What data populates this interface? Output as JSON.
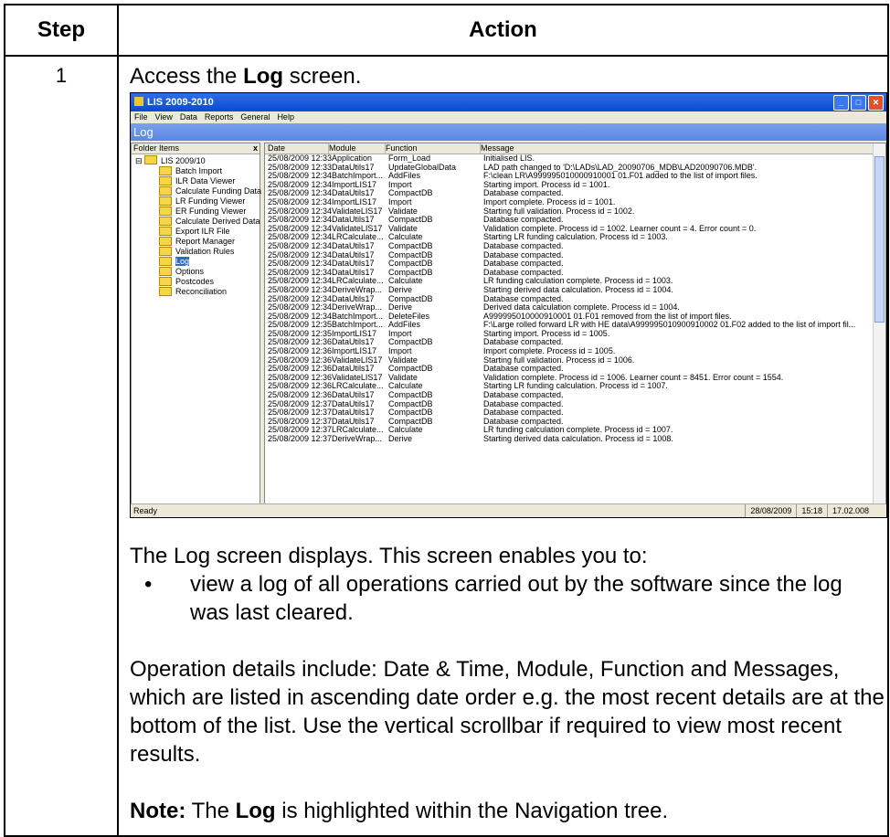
{
  "table": {
    "step_header": "Step",
    "action_header": "Action",
    "step_number": "1"
  },
  "intro": {
    "prefix": "Access the ",
    "bold": "Log",
    "suffix": " screen."
  },
  "screenshot": {
    "app_title": "LIS 2009-2010",
    "menu": [
      "File",
      "View",
      "Data",
      "Reports",
      "General",
      "Help"
    ],
    "screen_title": "Log",
    "folder_panel_title": "Folder Items",
    "tree_root": "LIS 2009/10",
    "tree_items": [
      "Batch Import",
      "ILR Data Viewer",
      "Calculate Funding Data",
      "LR Funding Viewer",
      "ER Funding Viewer",
      "Calculate Derived Data",
      "Export ILR File",
      "Report Manager",
      "Validation Rules",
      "Log",
      "Options",
      "Postcodes",
      "Reconciliation"
    ],
    "selected_item": "Log",
    "columns": [
      "Date",
      "Module",
      "Function",
      "Message"
    ],
    "rows": [
      [
        "25/08/2009 12:33",
        "Application",
        "Form_Load",
        "Initialised LIS."
      ],
      [
        "25/08/2009 12:33",
        "DataUtils17",
        "UpdateGlobalData",
        "LAD path changed to 'D:\\LADs\\LAD_20090706_MDB\\LAD20090706.MDB'."
      ],
      [
        "25/08/2009 12:34",
        "BatchImport...",
        "AddFiles",
        "F:\\clean LR\\A999995010000910001 01.F01 added to the list of import files."
      ],
      [
        "25/08/2009 12:34",
        "ImportLIS17",
        "Import",
        "Starting import. Process id = 1001."
      ],
      [
        "25/08/2009 12:34",
        "DataUtils17",
        "CompactDB",
        "Database compacted."
      ],
      [
        "25/08/2009 12:34",
        "ImportLIS17",
        "Import",
        "Import complete. Process id = 1001."
      ],
      [
        "25/08/2009 12:34",
        "ValidateLIS17",
        "Validate",
        "Starting full validation. Process id = 1002."
      ],
      [
        "25/08/2009 12:34",
        "DataUtils17",
        "CompactDB",
        "Database compacted."
      ],
      [
        "25/08/2009 12:34",
        "ValidateLIS17",
        "Validate",
        "Validation complete. Process id = 1002. Learner count = 4. Error count = 0."
      ],
      [
        "25/08/2009 12:34",
        "LRCalculate...",
        "Calculate",
        "Starting LR funding calculation. Process id = 1003."
      ],
      [
        "25/08/2009 12:34",
        "DataUtils17",
        "CompactDB",
        "Database compacted."
      ],
      [
        "25/08/2009 12:34",
        "DataUtils17",
        "CompactDB",
        "Database compacted."
      ],
      [
        "25/08/2009 12:34",
        "DataUtils17",
        "CompactDB",
        "Database compacted."
      ],
      [
        "25/08/2009 12:34",
        "DataUtils17",
        "CompactDB",
        "Database compacted."
      ],
      [
        "25/08/2009 12:34",
        "LRCalculate...",
        "Calculate",
        "LR funding calculation complete. Process id = 1003."
      ],
      [
        "25/08/2009 12:34",
        "DeriveWrap...",
        "Derive",
        "Starting derived data calculation. Process id = 1004."
      ],
      [
        "25/08/2009 12:34",
        "DataUtils17",
        "CompactDB",
        "Database compacted."
      ],
      [
        "25/08/2009 12:34",
        "DeriveWrap...",
        "Derive",
        "Derived data calculation complete. Process id = 1004."
      ],
      [
        "25/08/2009 12:34",
        "BatchImport...",
        "DeleteFiles",
        "A999995010000910001 01.F01 removed from the list of import files."
      ],
      [
        "25/08/2009 12:35",
        "BatchImport...",
        "AddFiles",
        "F:\\Large rolled forward LR with HE data\\A999995010900910002 01.F02 added to the list of import fil..."
      ],
      [
        "25/08/2009 12:35",
        "ImportLIS17",
        "Import",
        "Starting import. Process id = 1005."
      ],
      [
        "25/08/2009 12:36",
        "DataUtils17",
        "CompactDB",
        "Database compacted."
      ],
      [
        "25/08/2009 12:36",
        "ImportLIS17",
        "Import",
        "Import complete. Process id = 1005."
      ],
      [
        "25/08/2009 12:36",
        "ValidateLIS17",
        "Validate",
        "Starting full validation. Process id = 1006."
      ],
      [
        "25/08/2009 12:36",
        "DataUtils17",
        "CompactDB",
        "Database compacted."
      ],
      [
        "25/08/2009 12:36",
        "ValidateLIS17",
        "Validate",
        "Validation complete. Process id = 1006. Learner count = 8451. Error count = 1554."
      ],
      [
        "25/08/2009 12:36",
        "LRCalculate...",
        "Calculate",
        "Starting LR funding calculation. Process id = 1007."
      ],
      [
        "25/08/2009 12:36",
        "DataUtils17",
        "CompactDB",
        "Database compacted."
      ],
      [
        "25/08/2009 12:37",
        "DataUtils17",
        "CompactDB",
        "Database compacted."
      ],
      [
        "25/08/2009 12:37",
        "DataUtils17",
        "CompactDB",
        "Database compacted."
      ],
      [
        "25/08/2009 12:37",
        "DataUtils17",
        "CompactDB",
        "Database compacted."
      ],
      [
        "25/08/2009 12:37",
        "LRCalculate...",
        "Calculate",
        "LR funding calculation complete. Process id = 1007."
      ],
      [
        "25/08/2009 12:37",
        "DeriveWrap...",
        "Derive",
        "Starting derived data calculation. Process id = 1008."
      ]
    ],
    "status_text": "Ready",
    "status_date": "28/08/2009",
    "status_time": "15:18",
    "status_version": "17.02.008"
  },
  "body": {
    "para1": "The Log screen displays. This screen enables you to:",
    "bullet1": "view a log of all operations carried out by the software since the log was last cleared.",
    "para2": "Operation details include: Date & Time, Module, Function and Messages, which are listed in ascending date order e.g. the most recent details are at the bottom of the list. Use the vertical scrollbar if required to view most recent results.",
    "note_label": "Note:",
    "note_mid": " The ",
    "note_bold": "Log",
    "note_suffix": " is highlighted within the Navigation tree."
  }
}
